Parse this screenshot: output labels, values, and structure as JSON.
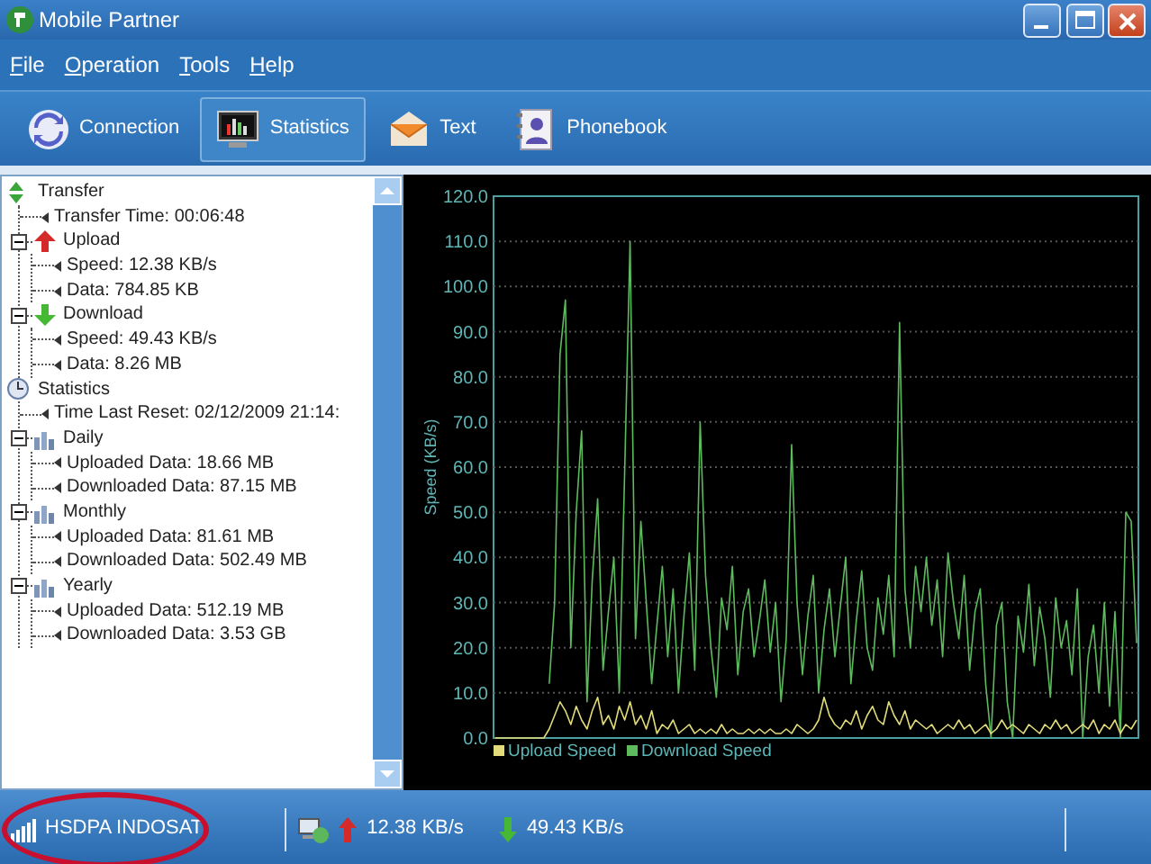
{
  "window": {
    "title": "Mobile Partner"
  },
  "menu": [
    {
      "label": "File"
    },
    {
      "label": "Operation"
    },
    {
      "label": "Tools"
    },
    {
      "label": "Help"
    }
  ],
  "toolbar": [
    {
      "label": "Connection",
      "selected": false
    },
    {
      "label": "Statistics",
      "selected": true
    },
    {
      "label": "Text",
      "selected": false
    },
    {
      "label": "Phonebook",
      "selected": false
    }
  ],
  "tree": [
    {
      "label": "Transfer",
      "kind": "transfer",
      "children": [
        {
          "label": "Transfer Time: 00:06:48"
        },
        {
          "label": "Upload",
          "kind": "upload",
          "expanded": true,
          "children": [
            {
              "label": "Speed: 12.38 KB/s"
            },
            {
              "label": "Data: 784.85 KB"
            }
          ]
        },
        {
          "label": "Download",
          "kind": "download",
          "expanded": true,
          "children": [
            {
              "label": "Speed: 49.43 KB/s"
            },
            {
              "label": "Data: 8.26 MB"
            }
          ]
        }
      ]
    },
    {
      "label": "Statistics",
      "kind": "statistics",
      "children": [
        {
          "label": "Time Last Reset: 02/12/2009 21:14:"
        },
        {
          "label": "Daily",
          "kind": "period",
          "expanded": true,
          "children": [
            {
              "label": "Uploaded Data: 18.66 MB"
            },
            {
              "label": "Downloaded Data: 87.15 MB"
            }
          ]
        },
        {
          "label": "Monthly",
          "kind": "period",
          "expanded": true,
          "children": [
            {
              "label": "Uploaded Data: 81.61 MB"
            },
            {
              "label": "Downloaded Data: 502.49 MB"
            }
          ]
        },
        {
          "label": "Yearly",
          "kind": "period",
          "expanded": true,
          "children": [
            {
              "label": "Uploaded Data: 512.19 MB"
            },
            {
              "label": "Downloaded Data: 3.53 GB"
            }
          ]
        }
      ]
    }
  ],
  "speed_graph": {
    "chart_data": {
      "type": "line",
      "ylabel": "Speed (KB/s)",
      "ylim": [
        0,
        120
      ],
      "grid": true,
      "legend": true,
      "yticks": [
        {
          "value": 0,
          "label": "0.0"
        },
        {
          "value": 10,
          "label": "10.0"
        },
        {
          "value": 20,
          "label": "20.0"
        },
        {
          "value": 30,
          "label": "30.0"
        },
        {
          "value": 40,
          "label": "40.0"
        },
        {
          "value": 50,
          "label": "50.0"
        },
        {
          "value": 60,
          "label": "60.0"
        },
        {
          "value": 70,
          "label": "70.0"
        },
        {
          "value": 80,
          "label": "80.0"
        },
        {
          "value": 90,
          "label": "90.0"
        },
        {
          "value": 100,
          "label": "100.0"
        },
        {
          "value": 110,
          "label": "110.0"
        },
        {
          "value": 120,
          "label": "120.0"
        }
      ],
      "series": [
        {
          "name": "Upload Speed",
          "color": "#e2dc7a",
          "values": [
            0,
            0,
            0,
            0,
            0,
            0,
            0,
            0,
            0,
            0,
            2,
            5,
            8,
            6,
            3,
            7,
            4,
            2,
            6,
            9,
            3,
            5,
            2,
            7,
            4,
            8,
            3,
            5,
            2,
            6,
            1,
            3,
            2,
            4,
            1,
            2,
            3,
            1,
            2,
            1,
            2,
            1,
            3,
            1,
            2,
            1,
            1,
            2,
            1,
            2,
            1,
            2,
            1,
            1,
            2,
            1,
            3,
            2,
            1,
            2,
            4,
            9,
            5,
            3,
            2,
            4,
            3,
            6,
            2,
            5,
            7,
            4,
            3,
            8,
            5,
            3,
            6,
            2,
            4,
            3,
            2,
            3,
            1,
            2,
            3,
            2,
            4,
            2,
            3,
            1,
            2,
            3,
            1,
            2,
            4,
            2,
            3,
            2,
            1,
            3,
            2,
            1,
            3,
            2,
            4,
            2,
            3,
            1,
            2,
            3,
            2,
            4,
            1,
            3,
            2,
            4,
            1,
            3,
            2,
            4
          ]
        },
        {
          "name": "Download Speed",
          "color": "#5dbb5d",
          "values": [
            null,
            null,
            null,
            null,
            null,
            null,
            null,
            null,
            null,
            null,
            12,
            30,
            85,
            97,
            20,
            50,
            68,
            8,
            35,
            53,
            15,
            28,
            40,
            10,
            59,
            110,
            22,
            48,
            30,
            12,
            25,
            38,
            18,
            33,
            10,
            27,
            41,
            15,
            70,
            36,
            20,
            9,
            31,
            24,
            38,
            14,
            28,
            33,
            18,
            26,
            35,
            19,
            30,
            8,
            22,
            65,
            30,
            14,
            27,
            36,
            10,
            24,
            33,
            18,
            29,
            40,
            12,
            26,
            37,
            20,
            15,
            31,
            23,
            36,
            18,
            92,
            33,
            20,
            38,
            28,
            40,
            25,
            35,
            18,
            41,
            30,
            22,
            36,
            15,
            28,
            33,
            12,
            0,
            25,
            30,
            8,
            0,
            27,
            19,
            34,
            16,
            29,
            22,
            9,
            31,
            20,
            26,
            14,
            33,
            0,
            18,
            25,
            10,
            30,
            7,
            28,
            0,
            50,
            48,
            21
          ]
        }
      ]
    }
  },
  "status_bar": {
    "network": "HSDPA INDOSAT",
    "upload_speed": "12.38 KB/s",
    "download_speed": "49.43 KB/s"
  }
}
